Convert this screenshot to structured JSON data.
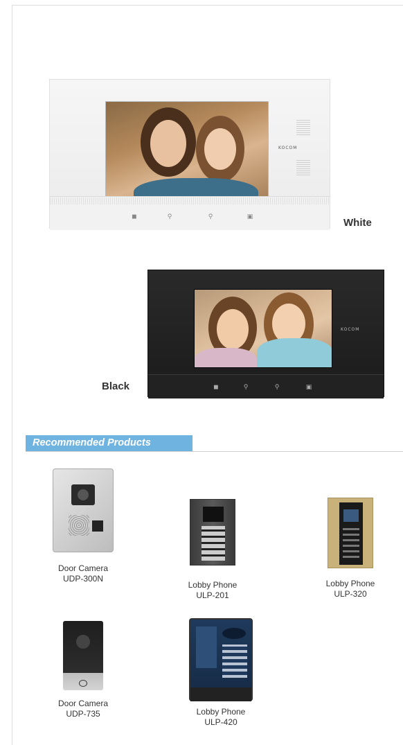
{
  "variants": {
    "white": {
      "label": "White",
      "brand": "KOCOM",
      "buttons": [
        "speaker-icon",
        "key-icon",
        "key-icon",
        "monitor-icon"
      ]
    },
    "black": {
      "label": "Black",
      "brand": "KOCOM",
      "buttons": [
        "speaker-icon",
        "key-icon",
        "key-icon",
        "monitor-icon"
      ]
    }
  },
  "recommended": {
    "title": "Recommended Products",
    "products": [
      {
        "name": "Door Camera",
        "model": "UDP-300N"
      },
      {
        "name": "Lobby Phone",
        "model": "ULP-201"
      },
      {
        "name": "Lobby Phone",
        "model": "ULP-320"
      },
      {
        "name": "Door Camera",
        "model": "UDP-735"
      },
      {
        "name": "Lobby Phone",
        "model": "ULP-420"
      }
    ]
  },
  "colors": {
    "section_tab": "#6fb3e0",
    "monitor_white": "#f2f2f2",
    "monitor_black": "#1f1f1f"
  }
}
